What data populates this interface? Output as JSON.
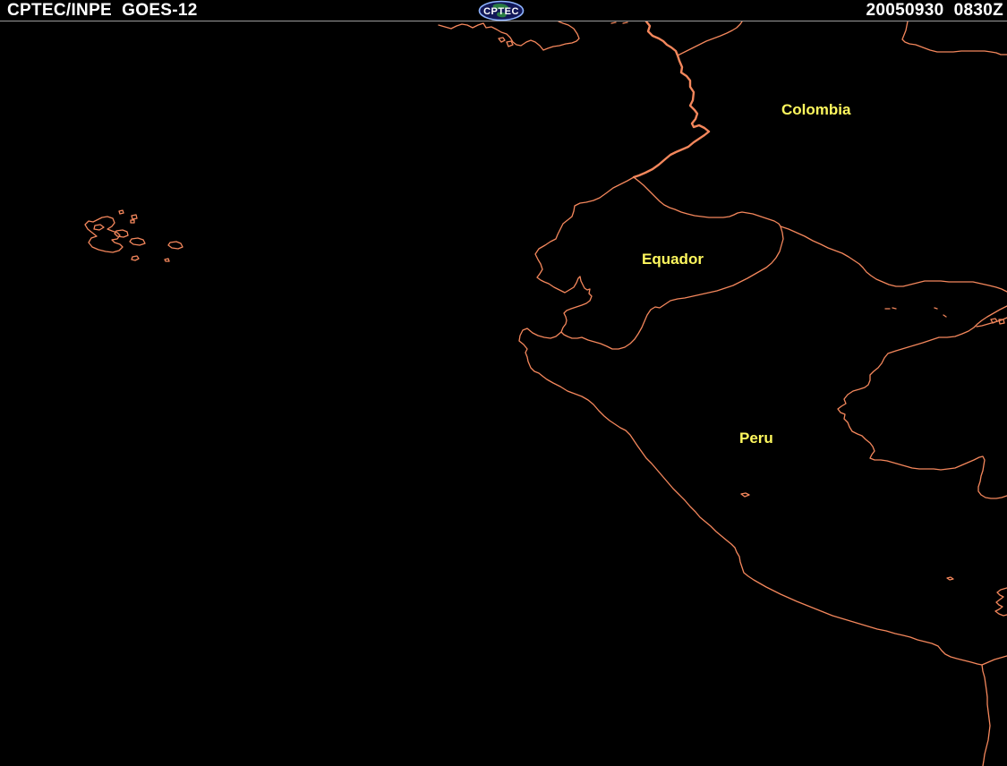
{
  "header": {
    "title": "CPTEC/INPE  GOES-12",
    "logo_text": "CPTEC",
    "timestamp": "20050930  0830Z"
  },
  "map": {
    "labels": [
      {
        "id": "colombia",
        "text": "Colombia"
      },
      {
        "id": "equador",
        "text": "Equador"
      },
      {
        "id": "peru",
        "text": "Peru"
      }
    ]
  },
  "colors": {
    "coastline": "#F4875C",
    "label-yellow": "#FFF85E",
    "header-text": "#FFFFFF",
    "divider": "#9A9A9A",
    "logo-ring": "#8FB4FF",
    "logo-fill": "#121858",
    "logo-land": "#2F8F3F",
    "background": "#000000"
  }
}
